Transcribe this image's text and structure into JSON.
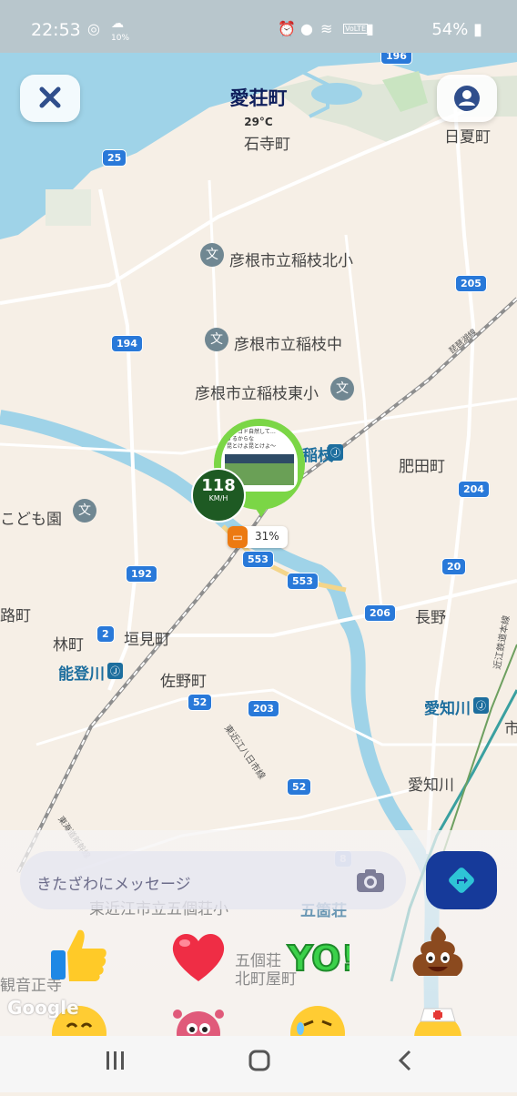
{
  "status_bar": {
    "time": "22:53",
    "weather_sub": "10%",
    "battery": "54%",
    "volte": "VoLTE"
  },
  "header": {
    "town_name": "愛荘町",
    "temperature": "29°C"
  },
  "map": {
    "labels": {
      "ishidera": "石寺町",
      "hinatsu": "日夏町",
      "school1": "彦根市立稲枝北小",
      "school2": "彦根市立稲枝中",
      "school3": "彦根市立稲枝東小",
      "inae_station": "稲枝",
      "hitamachi": "肥田町",
      "kodomoen": "こども園",
      "nagano": "長野",
      "hayashi": "林町",
      "kakimi": "垣見町",
      "notogawa": "能登川",
      "sano": "佐野町",
      "echigawa_station": "愛知川",
      "echigawa": "愛知川",
      "tomachi": "路町",
      "gokasho": "五個荘\n北町屋町",
      "gokasho_station": "五箇荘",
      "school4": "東近江市立五個荘小",
      "kannonji": "観音正寺",
      "ichi": "市",
      "tokai_line": "琵琶湖線",
      "shinkansen": "東海道新幹線",
      "omi_line": "近江鉄道本線",
      "yokaichi_line": "東近江八日市線"
    },
    "routes": [
      "196",
      "25",
      "205",
      "194",
      "204",
      "192",
      "553",
      "553",
      "20",
      "206",
      "2",
      "52",
      "203",
      "52",
      "8"
    ],
    "marker_thumb_text_1": "…ナゴド自然して…",
    "marker_thumb_text_2": "するからな",
    "marker_thumb_text_3": "昆とけよ昆とけよ～",
    "speed_value": "118",
    "speed_unit": "KM/H",
    "battery_percent": "31%",
    "attribution": "Google"
  },
  "composer": {
    "placeholder": "きたざわにメッセージ"
  },
  "reactions": [
    "thumbs-up",
    "heart",
    "yo",
    "poop",
    "smile",
    "virus",
    "sad",
    "nurse"
  ],
  "icons": {
    "close": "close-icon",
    "profile": "profile-icon",
    "camera": "camera-icon",
    "navigate": "navigate-icon",
    "school": "school-icon",
    "train": "train-icon"
  },
  "colors": {
    "route": "#2979d9",
    "marker_ring": "#7bd646",
    "speed_bg": "#1e5a23",
    "nav_button": "#163a9a",
    "water": "#9fd3e8",
    "status_bar": "#b8c6cc"
  }
}
